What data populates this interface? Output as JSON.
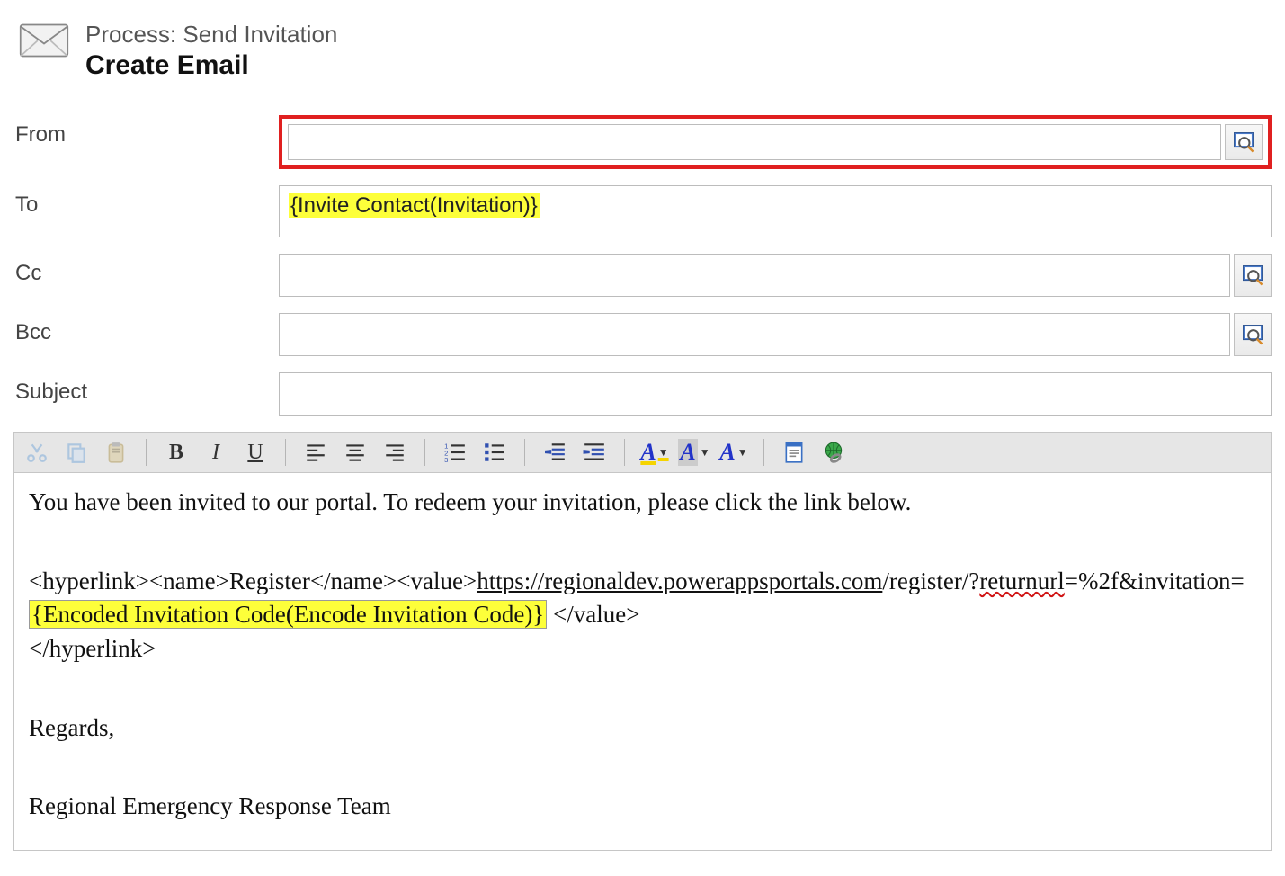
{
  "header": {
    "process_label": "Process: Send Invitation",
    "title": "Create Email"
  },
  "labels": {
    "from": "From",
    "to": "To",
    "cc": "Cc",
    "bcc": "Bcc",
    "subject": "Subject"
  },
  "fields": {
    "from": "",
    "to_token": "{Invite Contact(Invitation)}",
    "cc": "",
    "bcc": "",
    "subject": ""
  },
  "toolbar": {
    "bold": "B",
    "italic": "I",
    "underline": "U",
    "font_highlight": "A",
    "font_bg": "A",
    "font_color": "A"
  },
  "body": {
    "line1": "You have been invited to our portal. To redeem your invitation, please click the link below.",
    "hl_open": "<hyperlink><name>Register</name><value>",
    "url_part1": "https://regionaldev.powerappsportals.com",
    "url_part2": "/register/?",
    "url_returnurl": "returnurl",
    "url_part3": "=%2f&invitation=",
    "token": "{Encoded Invitation Code(Encode Invitation Code)}",
    "hl_close_value": "  </value>",
    "hl_close": "</hyperlink>",
    "regards": "Regards,",
    "signature": "Regional Emergency Response Team"
  }
}
